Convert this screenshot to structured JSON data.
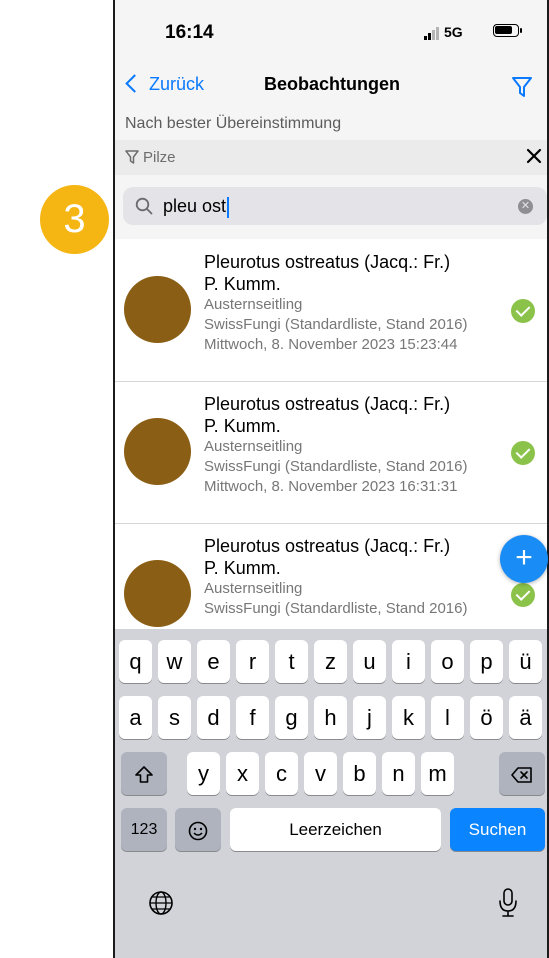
{
  "step_badge": "3",
  "status": {
    "time": "16:14",
    "network": "5G"
  },
  "nav": {
    "back_label": "Zurück",
    "title": "Beobachtungen"
  },
  "sort_label": "Nach bester Übereinstimmung",
  "filter": {
    "label": "Pilze"
  },
  "search": {
    "value": "pleu ost"
  },
  "results": [
    {
      "name_line1": "Pleurotus ostreatus (Jacq.: Fr.)",
      "name_line2": "P. Kumm.",
      "common": "Austernseitling",
      "list": "SwissFungi (Standardliste, Stand 2016)",
      "date": "Mittwoch, 8. November 2023 15:23:44"
    },
    {
      "name_line1": "Pleurotus ostreatus (Jacq.: Fr.)",
      "name_line2": "P. Kumm.",
      "common": "Austernseitling",
      "list": "SwissFungi (Standardliste, Stand 2016)",
      "date": "Mittwoch, 8. November 2023 16:31:31"
    },
    {
      "name_line1": "Pleurotus ostreatus (Jacq.: Fr.)",
      "name_line2": "P. Kumm.",
      "common": "Austernseitling",
      "list": "SwissFungi (Standardliste, Stand 2016)",
      "date": ""
    }
  ],
  "fab_label": "+",
  "keyboard": {
    "row1": [
      "q",
      "w",
      "e",
      "r",
      "t",
      "z",
      "u",
      "i",
      "o",
      "p",
      "ü"
    ],
    "row2": [
      "a",
      "s",
      "d",
      "f",
      "g",
      "h",
      "j",
      "k",
      "l",
      "ö",
      "ä"
    ],
    "row3": [
      "y",
      "x",
      "c",
      "v",
      "b",
      "n",
      "m"
    ],
    "numbers": "123",
    "space": "Leerzeichen",
    "action": "Suchen"
  },
  "colors": {
    "accent": "#0a7afe",
    "badge": "#f5b614",
    "avatar": "#8b5e15",
    "check": "#8bc34a"
  }
}
